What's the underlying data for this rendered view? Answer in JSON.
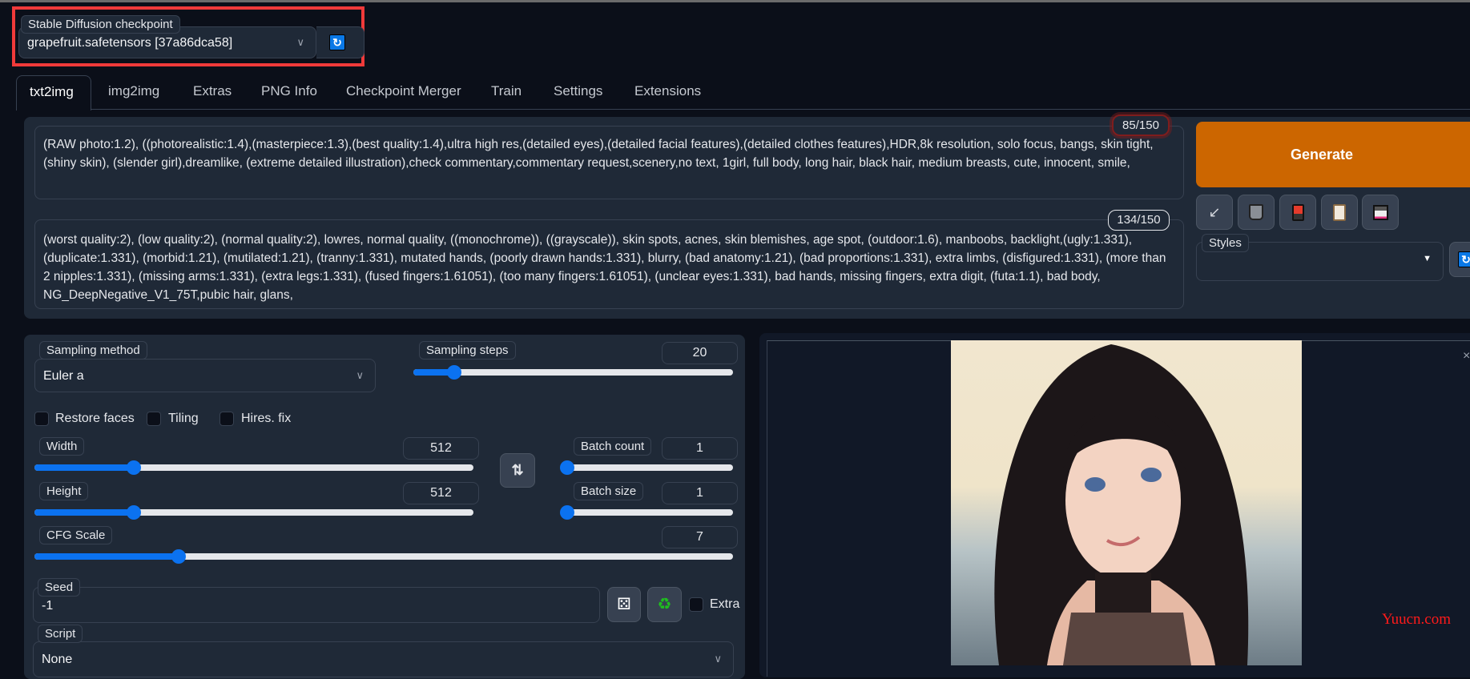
{
  "checkpoint": {
    "label": "Stable Diffusion checkpoint",
    "value": "grapefruit.safetensors [37a86dca58]",
    "refresh_icon": "refresh-icon"
  },
  "tabs": [
    {
      "label": "txt2img",
      "active": true
    },
    {
      "label": "img2img"
    },
    {
      "label": "Extras"
    },
    {
      "label": "PNG Info"
    },
    {
      "label": "Checkpoint Merger"
    },
    {
      "label": "Train"
    },
    {
      "label": "Settings"
    },
    {
      "label": "Extensions"
    }
  ],
  "prompt": {
    "text": "(RAW photo:1.2), ((photorealistic:1.4),(masterpiece:1.3),(best quality:1.4),ultra high res,(detailed eyes),(detailed facial features),(detailed clothes features),HDR,8k resolution, solo focus, bangs, skin tight, (shiny skin), (slender girl),dreamlike, (extreme detailed illustration),check commentary,commentary request,scenery,no text, 1girl, full body, long hair, black hair, medium breasts, cute, innocent, smile,",
    "token_count": "85/150"
  },
  "negative_prompt": {
    "text": "(worst quality:2), (low quality:2), (normal quality:2), lowres, normal quality, ((monochrome)), ((grayscale)), skin spots, acnes, skin blemishes, age spot, (outdoor:1.6), manboobs, backlight,(ugly:1.331), (duplicate:1.331), (morbid:1.21), (mutilated:1.21), (tranny:1.331), mutated hands, (poorly drawn hands:1.331), blurry, (bad anatomy:1.21), (bad proportions:1.331), extra limbs, (disfigured:1.331), (more than 2 nipples:1.331), (missing arms:1.331), (extra legs:1.331), (fused fingers:1.61051), (too many fingers:1.61051), (unclear eyes:1.331), bad hands, missing fingers, extra digit, (futa:1.1), bad body, NG_DeepNegative_V1_75T,pubic hair, glans,",
    "token_count": "134/150"
  },
  "actions": {
    "generate_label": "Generate",
    "generate_color": "#cc6600",
    "tools": [
      "arrow-down-left-icon",
      "trash-icon",
      "red-card-icon",
      "clipboard-icon",
      "floppy-disk-icon"
    ]
  },
  "styles": {
    "label": "Styles",
    "value": ""
  },
  "sampling": {
    "method_label": "Sampling method",
    "method_value": "Euler a",
    "steps_label": "Sampling steps",
    "steps_value": "20",
    "steps_range": [
      1,
      150
    ]
  },
  "checkboxes": [
    {
      "label": "Restore faces",
      "checked": false
    },
    {
      "label": "Tiling",
      "checked": false
    },
    {
      "label": "Hires. fix",
      "checked": false
    }
  ],
  "width": {
    "label": "Width",
    "value": "512",
    "range": [
      64,
      2048
    ]
  },
  "height": {
    "label": "Height",
    "value": "512",
    "range": [
      64,
      2048
    ]
  },
  "batch_count": {
    "label": "Batch count",
    "value": "1",
    "range": [
      1,
      100
    ]
  },
  "batch_size": {
    "label": "Batch size",
    "value": "1",
    "range": [
      1,
      8
    ]
  },
  "cfg": {
    "label": "CFG Scale",
    "value": "7",
    "range": [
      1,
      30
    ]
  },
  "seed": {
    "label": "Seed",
    "value": "-1",
    "extra_label": "Extra"
  },
  "script": {
    "label": "Script",
    "value": "None"
  },
  "output": {
    "watermark": "Yuucn.com",
    "close_icon": "close-icon"
  },
  "colors": {
    "accent": "#0b72f0",
    "background": "#0b0f19",
    "panel": "#1f2937",
    "highlight": "#f03a3a"
  }
}
